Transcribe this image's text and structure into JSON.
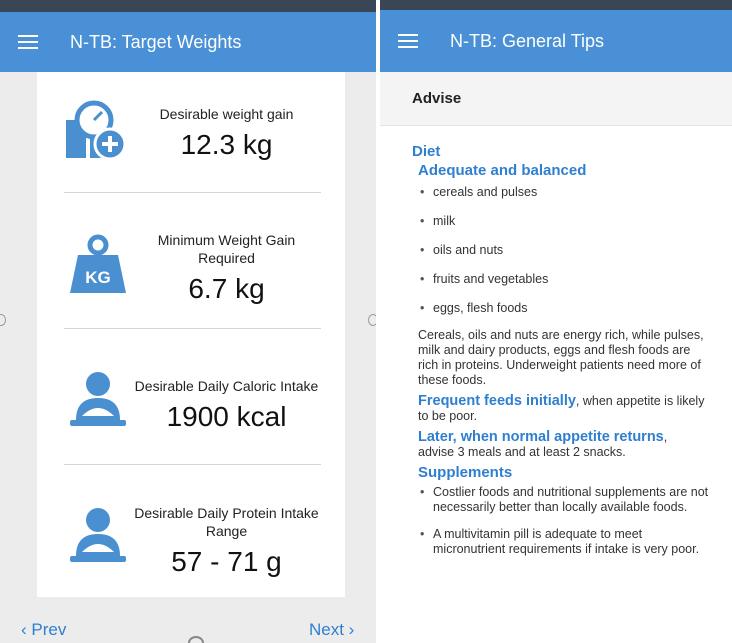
{
  "left": {
    "app_title": "N-TB: Target Weights",
    "stats": [
      {
        "label": "Desirable weight gain",
        "value": "12.3 kg",
        "icon": "weight-scale-add-icon"
      },
      {
        "label": "Minimum Weight Gain Required",
        "value": "6.7 kg",
        "icon": "kg-weight-icon"
      },
      {
        "label": "Desirable Daily Caloric Intake",
        "value": "1900 kcal",
        "icon": "person-eating-icon"
      },
      {
        "label": "Desirable Daily Protein Intake Range",
        "value": "57 - 71 g",
        "icon": "person-eating-icon"
      }
    ],
    "prev_label": "‹ Prev",
    "next_label": "Next ›"
  },
  "right": {
    "app_title": "N-TB: General Tips",
    "section_header": "Advise",
    "diet_heading": "Diet",
    "balanced_heading": "Adequate and balanced",
    "foods": [
      "cereals and pulses",
      "milk",
      "oils and nuts",
      "fruits and vegetables",
      "eggs, flesh foods"
    ],
    "foods_note": "Cereals, oils and nuts are energy rich, while pulses, milk and dairy products, eggs and flesh foods are rich in proteins. Underweight patients need more of these foods.",
    "frequent_heading": "Frequent feeds initially",
    "frequent_text": ", when appetite is likely to be poor.",
    "later_heading": "Later, when normal appetite returns",
    "later_text": ",",
    "later_advice": "advise 3 meals and at least 2 snacks.",
    "supplements_heading": "Supplements",
    "supplements": [
      "Costlier foods and nutritional supplements are not necessarily better than locally available foods.",
      "A multivitamin pill is adequate to meet micronutrient requirements if intake is very poor."
    ]
  },
  "colors": {
    "accent": "#4a90d6",
    "link": "#2f7fd0",
    "icon": "#4a8fd0"
  }
}
